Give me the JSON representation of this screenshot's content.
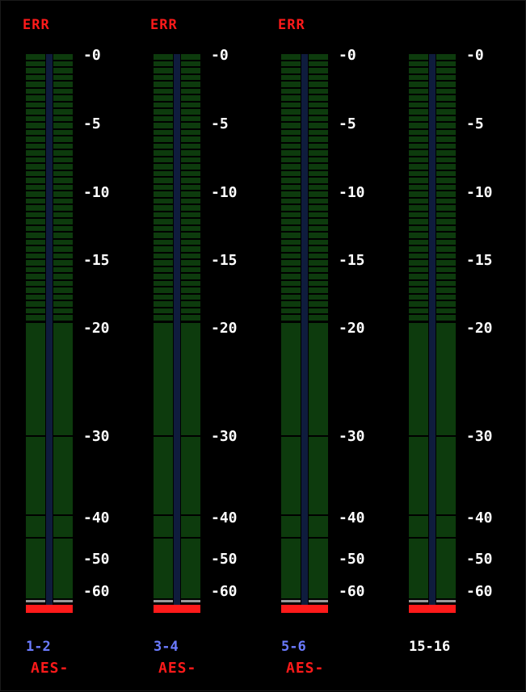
{
  "panel": {
    "background": "#000000",
    "colors": {
      "error": "#ff1a1a",
      "segment_off": "#0d3b0d",
      "centerline": "#0f1c3d",
      "peak": "#ff1a1a",
      "scale_text": "#ffffff",
      "channel_blue": "#6b7bff",
      "channel_white": "#ffffff",
      "source_red": "#ff1a1a"
    }
  },
  "scale_labels": [
    "-0",
    "-5",
    "-10",
    "-15",
    "-20",
    "-30",
    "-40",
    "-50",
    "-60"
  ],
  "meters": [
    {
      "err_label": "ERR",
      "channel_label": "1-2",
      "channel_color": "#6b7bff",
      "source_label": "AES-",
      "left_level": 0,
      "right_level": 0
    },
    {
      "err_label": "ERR",
      "channel_label": "3-4",
      "channel_color": "#6b7bff",
      "source_label": "AES-",
      "left_level": 0,
      "right_level": 0
    },
    {
      "err_label": "ERR",
      "channel_label": "5-6",
      "channel_color": "#6b7bff",
      "source_label": "AES-",
      "left_level": 0,
      "right_level": 0
    },
    {
      "err_label": "",
      "channel_label": "15-16",
      "channel_color": "#ffffff",
      "source_label": "",
      "left_level": 0,
      "right_level": 0
    }
  ]
}
